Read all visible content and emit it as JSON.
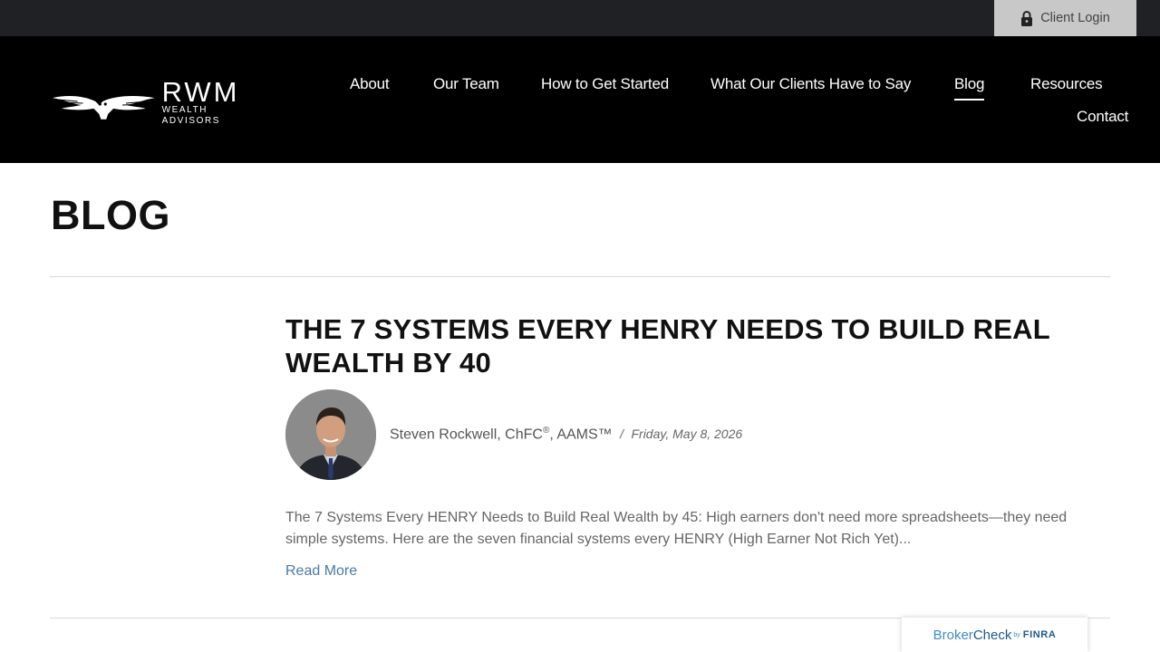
{
  "utility": {
    "client_login": "Client Login"
  },
  "logo": {
    "name": "RWM",
    "tagline": "WEALTH ADVISORS"
  },
  "nav": {
    "items": [
      {
        "label": "About"
      },
      {
        "label": "Our Team"
      },
      {
        "label": "How to Get Started"
      },
      {
        "label": "What Our Clients Have to Say"
      },
      {
        "label": "Blog",
        "active": true
      },
      {
        "label": "Resources"
      },
      {
        "label": "Contact"
      }
    ]
  },
  "page": {
    "title": "BLOG"
  },
  "post": {
    "title": "THE 7 SYSTEMS EVERY HENRY NEEDS TO BUILD REAL WEALTH BY 40",
    "author_name": "Steven Rockwell, ChFC",
    "author_reg": "®",
    "author_suffix": ", AAMS™",
    "separator": "/",
    "date": "Friday, May 8, 2026",
    "excerpt": "The 7 Systems Every HENRY Needs to Build Real Wealth by 45: High earners don't need more spreadsheets—they need simple systems. Here are the seven financial systems every HENRY (High Earner Not Rich Yet)...",
    "read_more": "Read More"
  },
  "brokercheck": {
    "broker": "Broker",
    "check": "Check",
    "by": "by",
    "finra": "FINRA"
  },
  "colors": {
    "header_bg": "#000000",
    "utility_bg": "#1f2124",
    "link": "#4a7aa8",
    "login_bg": "#c8c8c8"
  },
  "icons": {
    "login": "lock-icon",
    "logo": "owl-icon"
  }
}
